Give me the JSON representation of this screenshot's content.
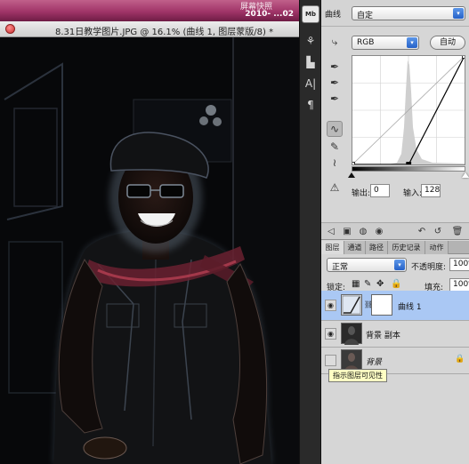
{
  "mac_menubar": {
    "line1": "屏幕快照",
    "line2": "2010-  ...02"
  },
  "document": {
    "title": "8.31日教学图片.JPG @ 16.1% (曲线 1, 图层蒙版/8) *"
  },
  "tools": [
    {
      "icon": "mini-bridge-icon",
      "label": "Mb"
    },
    {
      "icon": "clone-source-icon",
      "glyph": "⚘"
    },
    {
      "icon": "brush-preset-icon",
      "glyph": "▙"
    },
    {
      "icon": "character-icon",
      "glyph": "A|"
    },
    {
      "icon": "paragraph-icon",
      "glyph": "¶"
    }
  ],
  "adjustments": {
    "header_label": "曲线",
    "preset_value": "自定",
    "channel_value": "RGB",
    "auto_button": "自动",
    "output_label": "输出:",
    "output_value": "0",
    "input_label": "输入:",
    "input_value": "128",
    "curve_points": [
      {
        "in": 0,
        "out": 0
      },
      {
        "in": 128,
        "out": 0
      },
      {
        "in": 255,
        "out": 255
      }
    ]
  },
  "layers_panel": {
    "tabs": [
      "图层",
      "通道",
      "路径",
      "历史记录",
      "动作"
    ],
    "blend_mode": "正常",
    "opacity_label": "不透明度:",
    "opacity_value": "100%",
    "lock_label": "锁定:",
    "fill_label": "填充:",
    "fill_value": "100%",
    "layers": [
      {
        "name": "曲线 1",
        "selected": true,
        "visible": true,
        "type": "adjustment"
      },
      {
        "name": "背景 副本",
        "selected": false,
        "visible": true,
        "type": "pixel"
      },
      {
        "name": "背景",
        "selected": false,
        "visible": false,
        "type": "background",
        "locked": true
      }
    ]
  },
  "tooltip": "指示图层可见性",
  "colors": {
    "selected_layer": "#aac8f4",
    "accent_blue": "#2662c8",
    "titlebar_pink": "#a03468"
  }
}
